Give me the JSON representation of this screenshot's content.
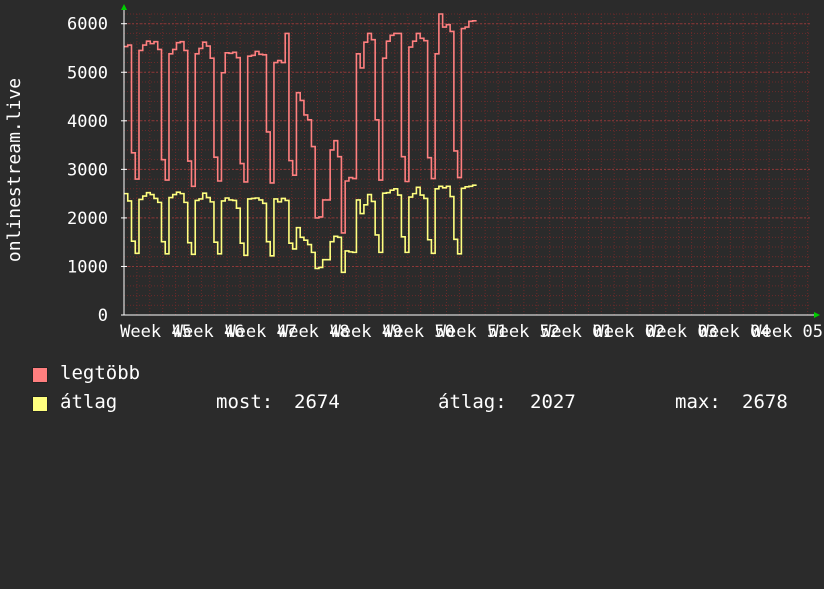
{
  "chart_data": {
    "type": "line",
    "ylabel": "onlinestream.live",
    "ylim": [
      0,
      6200
    ],
    "yticks": [
      0,
      1000,
      2000,
      3000,
      4000,
      5000,
      6000
    ],
    "xticks": [
      "Week 45",
      "Week 46",
      "Week 47",
      "Week 48",
      "Week 49",
      "Week 50",
      "Week 51",
      "Week 52",
      "Week 01",
      "Week 02",
      "Week 03",
      "Week 04",
      "Week 05"
    ],
    "grid": true,
    "colors": {
      "background": "#2b2b2b",
      "plot": "#2b2b2b",
      "grid": "#6a2a2a",
      "axis": "#ffffff",
      "arrow": "#00cc00"
    },
    "x": [
      0,
      0.5,
      1,
      1.5,
      2,
      2.5,
      3,
      3.5,
      4,
      4.5,
      5,
      5.5,
      6,
      6.5,
      7,
      7.5,
      8,
      8.5,
      9,
      9.5,
      10,
      10.5,
      11,
      11.5,
      12,
      12.5,
      13,
      13.5,
      14,
      14.5,
      15,
      15.5,
      16,
      16.5,
      17,
      17.5,
      18,
      18.5,
      19,
      19.5,
      20,
      20.5,
      21,
      21.5,
      22,
      22.5,
      23,
      23.5,
      24,
      24.5,
      25,
      25.5,
      26,
      26.5,
      27,
      27.5,
      28,
      28.5,
      29,
      29.5,
      30,
      30.5,
      31,
      31.5,
      32,
      32.5,
      33,
      33.5,
      34,
      34.5,
      35,
      35.5,
      36,
      36.5,
      37,
      37.5,
      38,
      38.5,
      39,
      39.5,
      40,
      40.5,
      41,
      41.5,
      42,
      42.5,
      43,
      43.5,
      44,
      44.5,
      45,
      45.5,
      46,
      46.5,
      47,
      47.5,
      48,
      48.5,
      49,
      49.5,
      50,
      50.5,
      51,
      51.5,
      52,
      52.5,
      53,
      53.5,
      54,
      54.5,
      55,
      55.5,
      56,
      56.5,
      57,
      57.5,
      58,
      58.5,
      59,
      59.5,
      60,
      60.5,
      61,
      61.5,
      62,
      62.5,
      63,
      63.5,
      64,
      64.5,
      65,
      65.5,
      66,
      66.5,
      67,
      67.5,
      68,
      68.5,
      69,
      69.5,
      70,
      70.5,
      71,
      71.5,
      72,
      72.5,
      73,
      73.5,
      74,
      74.5,
      75,
      75.5,
      76,
      76.5,
      77,
      77.5,
      78,
      78.5,
      79,
      79.5,
      80,
      80.5,
      81,
      81.5,
      82,
      82.5,
      83,
      83.5,
      84,
      84.5,
      85,
      85.5,
      86,
      86.5,
      87,
      87.5,
      88,
      88.5,
      89,
      89.5,
      90,
      90.5,
      91,
      91.5
    ],
    "series": [
      {
        "name": "legtöbb",
        "color": "#ff7f7f",
        "values": [
          5530,
          5560,
          3340,
          2800,
          5450,
          5560,
          5640,
          5590,
          5630,
          5470,
          3200,
          2780,
          5380,
          5470,
          5610,
          5630,
          5450,
          3170,
          2650,
          5380,
          5490,
          5620,
          5540,
          5290,
          3250,
          2760,
          4990,
          5400,
          5390,
          5410,
          5300,
          3120,
          2740,
          5330,
          5350,
          5430,
          5370,
          5360,
          3770,
          2720,
          5200,
          5240,
          5200,
          5800,
          3180,
          2880,
          4580,
          4420,
          4120,
          4020,
          3470,
          2000,
          2020,
          2370,
          2370,
          3400,
          3590,
          3260,
          1690,
          2760,
          2830,
          2810,
          5380,
          5090,
          5620,
          5800,
          5670,
          4020,
          2780,
          5290,
          5640,
          5760,
          5800,
          5800,
          3260,
          2750,
          5520,
          5640,
          5800,
          5700,
          5650,
          3240,
          2810,
          5380,
          6200,
          5930,
          5980,
          5840,
          3380,
          2830,
          5900,
          5930,
          6050,
          6060
        ],
        "legend": {
          "label": "legtöbb",
          "color": "#ff7f7f"
        }
      },
      {
        "name": "átlag",
        "color": "#ffff7f",
        "values": [
          2500,
          2350,
          1520,
          1270,
          2380,
          2450,
          2520,
          2480,
          2400,
          2320,
          1510,
          1260,
          2420,
          2480,
          2530,
          2500,
          2320,
          1490,
          1250,
          2360,
          2390,
          2510,
          2420,
          2330,
          1500,
          1260,
          2350,
          2410,
          2370,
          2360,
          2200,
          1480,
          1230,
          2390,
          2400,
          2410,
          2370,
          2300,
          1510,
          1220,
          2390,
          2330,
          2400,
          2360,
          1480,
          1360,
          1800,
          1600,
          1540,
          1450,
          1290,
          960,
          980,
          1140,
          1140,
          1510,
          1620,
          1600,
          880,
          1320,
          1300,
          1290,
          2370,
          2090,
          2270,
          2480,
          2340,
          1650,
          1290,
          2510,
          2520,
          2570,
          2600,
          2470,
          1610,
          1290,
          2430,
          2500,
          2630,
          2470,
          2400,
          1550,
          1270,
          2600,
          2650,
          2620,
          2650,
          2440,
          1560,
          1260,
          2610,
          2640,
          2650,
          2674
        ],
        "legend": {
          "label": "átlag",
          "color": "#ffff7f"
        }
      }
    ],
    "stats": {
      "now_label": "most:",
      "now": "2674",
      "avg_label": "átlag:",
      "avg": "2027",
      "max_label": "max:",
      "max": "2678"
    }
  }
}
